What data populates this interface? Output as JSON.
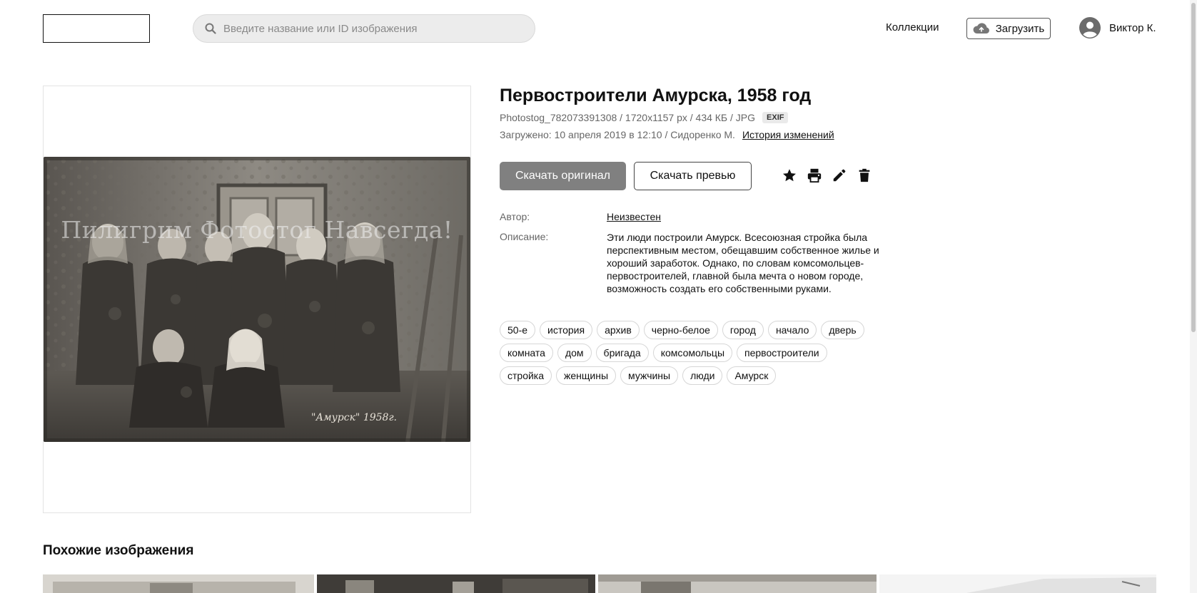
{
  "header": {
    "search_placeholder": "Введите название или ID изображения",
    "collections_label": "Коллекции",
    "upload_label": "Загрузить",
    "user_name": "Виктор К."
  },
  "image": {
    "watermark": "Пилигрим Фотостог Навсегда!",
    "handwritten_caption": "\"Амурск\" 1958г."
  },
  "details": {
    "title": "Первостроители Амурска, 1958 год",
    "file_info": "Photostog_782073391308 / 1720x1157 px / 434 КБ / JPG",
    "exif_badge": "EXIF",
    "uploaded_info": "Загружено: 10 апреля 2019 в 12:10 / Сидоренко М.",
    "history_link": "История изменений",
    "download_original": "Скачать оригинал",
    "download_preview": "Скачать превью",
    "action_icons": [
      "star-icon",
      "print-icon",
      "pencil-icon",
      "trash-icon"
    ],
    "author_label": "Автор:",
    "author_value": "Неизвестен",
    "description_label": "Описание:",
    "description": "Эти люди построили Амурск. Всесоюзная стройка была перспективным местом, обещавшим собственное жилье и хороший заработок. Однако, по словам комсомольцев-первостроителей, главной была мечта о новом городе, возможность создать его собственными руками."
  },
  "tags": [
    "50-е",
    "история",
    "архив",
    "черно-белое",
    "город",
    "начало",
    "дверь",
    "комната",
    "дом",
    "бригада",
    "комсомольцы",
    "первостроители",
    "стройка",
    "женщины",
    "мужчины",
    "люди",
    "Амурск"
  ],
  "similar": {
    "title": "Похожие изображения"
  },
  "colors": {
    "primary_button": "#808080",
    "tag_border": "#d6d6d6",
    "muted_text": "#666666"
  }
}
